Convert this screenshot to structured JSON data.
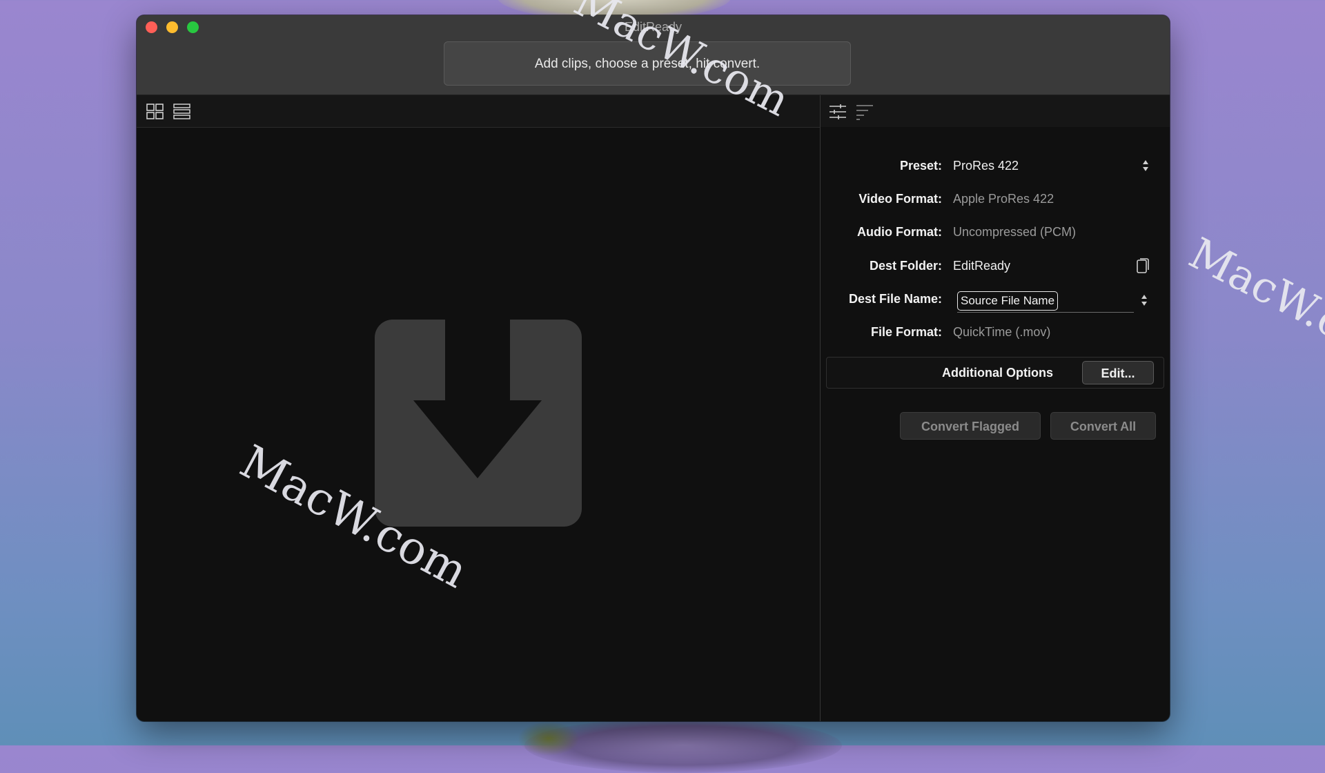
{
  "window": {
    "title": "EditReady",
    "status": "Add clips, choose a preset, hit convert."
  },
  "left_toolbar": {
    "grid_view_icon": "grid-view-icon",
    "list_view_icon": "list-view-icon"
  },
  "right_toolbar": {
    "settings_icon": "sliders-icon",
    "sort_icon": "sort-lines-icon"
  },
  "dropzone": {
    "icon": "drop-down-arrow-icon"
  },
  "properties": {
    "preset": {
      "label": "Preset:",
      "value": "ProRes 422"
    },
    "video_format": {
      "label": "Video Format:",
      "value": "Apple ProRes 422"
    },
    "audio_format": {
      "label": "Audio Format:",
      "value": "Uncompressed (PCM)"
    },
    "dest_folder": {
      "label": "Dest Folder:",
      "value": "EditReady"
    },
    "dest_file_name": {
      "label": "Dest File Name:",
      "token": "Source File Name"
    },
    "file_format": {
      "label": "File Format:",
      "value": "QuickTime (.mov)"
    }
  },
  "additional_options": {
    "label": "Additional Options",
    "edit_button": "Edit..."
  },
  "actions": {
    "convert_flagged": "Convert Flagged",
    "convert_all": "Convert All"
  },
  "watermarks": {
    "text1": "MacW.com",
    "text2": "MacW.com",
    "text3": "MacW.c"
  },
  "colors": {
    "close": "#ff5f57",
    "minimize": "#febc2e",
    "maximize": "#28c840"
  }
}
